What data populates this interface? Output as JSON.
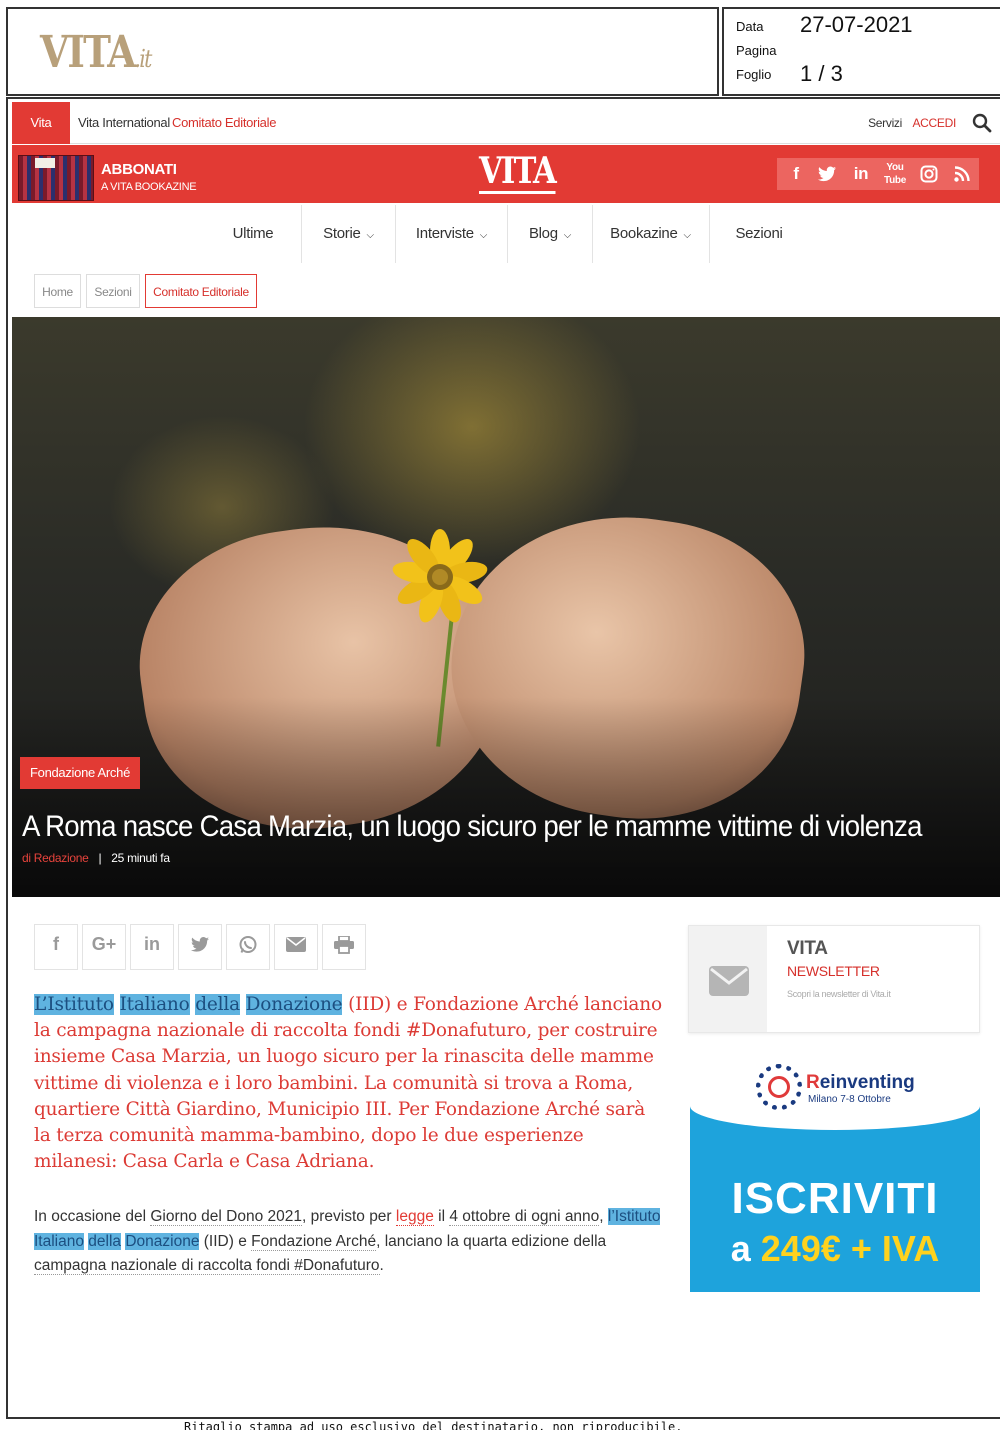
{
  "clipping": {
    "logo_main": "VITA",
    "logo_suffix": ".it",
    "labels": {
      "data": "Data",
      "pagina": "Pagina",
      "foglio": "Foglio"
    },
    "data_value": "27-07-2021",
    "foglio_value": "1 / 3"
  },
  "topnav": {
    "tabs": [
      "Vita",
      "Vita International",
      "Comitato Editoriale"
    ],
    "servizi": "Servizi",
    "accedi": "ACCEDI"
  },
  "banner": {
    "abbonati": "ABBONATI",
    "sub": "A VITA BOOKAZINE",
    "logo": "VITA",
    "social": [
      "facebook-icon",
      "twitter-icon",
      "linkedin-icon",
      "youtube-icon",
      "instagram-icon",
      "rss-icon"
    ]
  },
  "mainnav": {
    "items": [
      "Ultime",
      "Storie",
      "Interviste",
      "Blog",
      "Bookazine",
      "Sezioni"
    ]
  },
  "breadcrumb": [
    "Home",
    "Sezioni",
    "Comitato Editoriale"
  ],
  "hero": {
    "tag": "Fondazione Arché",
    "title": "A Roma nasce Casa Marzia, un luogo sicuro per le mamme vittime di violenza",
    "author": "di Redazione",
    "separator": "|",
    "time": "25 minuti fa"
  },
  "share": [
    "f",
    "G+",
    "in",
    "twitter",
    "whatsapp",
    "email",
    "print"
  ],
  "article": {
    "lead_hl": [
      "L’Istituto",
      "Italiano",
      "della",
      "Donazione"
    ],
    "lead_rest": " (IID) e Fondazione Arché lanciano la campagna nazionale di raccolta fondi #Donafuturo, per costruire insieme Casa Marzia, un luogo sicuro per la rinascita delle mamme vittime di violenza e i loro bambini. La comunità si trova a Roma, quartiere Città Giardino, Municipio III. Per Fondazione Arché sarà la terza comunità mamma-bambino, dopo le due esperienze milanesi: Casa Carla e Casa Adriana.",
    "p1_a": "In occasione del ",
    "p1_link1": "Giorno del Dono 2021",
    "p1_b": ", previsto per ",
    "p1_link2": "legge",
    "p1_c": " il ",
    "p1_link3": "4 ottobre di ogni anno",
    "p1_d": ", ",
    "p1_hl": [
      "l’Istituto",
      "Italiano",
      "della",
      "Donazione"
    ],
    "p1_e": " (IID) e ",
    "p1_link4": "Fondazione Arché",
    "p1_f": ", lanciano la quarta edizione della ",
    "p1_link5": "campagna nazionale di raccolta fondi #Donafuturo",
    "p1_g": "."
  },
  "newsletter": {
    "vita": "VITA",
    "title": "NEWSLETTER",
    "sub": "Scopri la newsletter di Vita.it"
  },
  "ad": {
    "brand": "Reinventing",
    "brand_first": "R",
    "date": "Milano 7-8 Ottobre",
    "cta": "ISCRIVITI",
    "price_a": "a ",
    "price_b": "249€ + IVA"
  },
  "footer": "Ritaglio   stampa   ad   uso   esclusivo   del   destinatario,   non   riproducibile."
}
